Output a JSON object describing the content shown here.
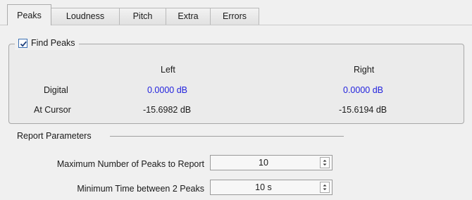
{
  "tabs": [
    {
      "label": "Peaks"
    },
    {
      "label": "Loudness"
    },
    {
      "label": "Pitch"
    },
    {
      "label": "Extra"
    },
    {
      "label": "Errors"
    }
  ],
  "find_peaks": {
    "label": "Find Peaks",
    "checked": true,
    "columns": {
      "left": "Left",
      "right": "Right"
    },
    "rows": [
      {
        "label": "Digital",
        "left": "0.0000 dB",
        "right": "0.0000 dB"
      },
      {
        "label": "At Cursor",
        "left": "-15.6982 dB",
        "right": "-15.6194 dB"
      }
    ],
    "colors": {
      "digital_values": "#2222dd"
    }
  },
  "report_parameters": {
    "title": "Report Parameters",
    "fields": [
      {
        "label": "Maximum Number of Peaks to Report",
        "value": "10"
      },
      {
        "label": "Minimum Time between 2 Peaks",
        "value": "10 s"
      }
    ]
  },
  "icons": {
    "checkbox": "checkmark-icon",
    "spinner": "up-down-arrows-icon"
  }
}
